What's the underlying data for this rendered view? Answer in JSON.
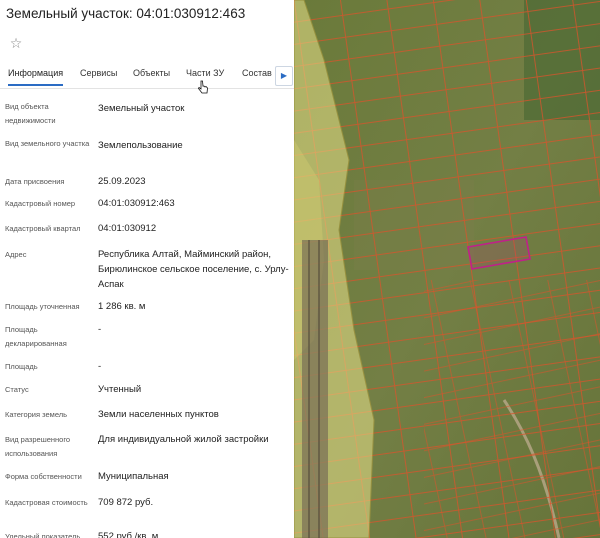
{
  "header": {
    "title": "Земельный участок: 04:01:030912:463"
  },
  "tabs": [
    "Информация",
    "Сервисы",
    "Объекты",
    "Части ЗУ",
    "Состав"
  ],
  "fields": [
    {
      "label": "Вид объекта недвижимости",
      "value": "Земельный участок"
    },
    {
      "label": "Вид земельного участка",
      "value": "Землепользование"
    },
    {
      "label": "Дата присвоения",
      "value": "25.09.2023"
    },
    {
      "label": "Кадастровый номер",
      "value": "04:01:030912:463"
    },
    {
      "label": "Кадастровый квартал",
      "value": "04:01:030912"
    },
    {
      "label": "Адрес",
      "value": "Республика Алтай, Майминский район, Бирюлинское сельское поселение, с. Урлу-Аспак"
    },
    {
      "label": "Площадь уточненная",
      "value": "1 286 кв. м"
    },
    {
      "label": "Площадь декларированная",
      "value": "-"
    },
    {
      "label": "Площадь",
      "value": "-"
    },
    {
      "label": "Статус",
      "value": "Учтенный"
    },
    {
      "label": "Категория земель",
      "value": "Земли населенных пунктов"
    },
    {
      "label": "Вид разрешенного использования",
      "value": "Для индивидуальной жилой застройки"
    },
    {
      "label": "Форма собственности",
      "value": "Муниципальная"
    },
    {
      "label": "Кадастровая стоимость",
      "value": "709 872 руб."
    },
    {
      "label": "Удельный показатель",
      "value": "552 руб./кв. м"
    }
  ],
  "colors": {
    "accent": "#2b6cc4",
    "selected_parcel": "#c0208a",
    "parcel_lines": "#d9532a",
    "zone_fill": "#e9e28a",
    "field_green": "#6f7c3f"
  },
  "icons": {
    "favorite": "star-icon",
    "scroll_tabs": "chevron-right-icon"
  }
}
